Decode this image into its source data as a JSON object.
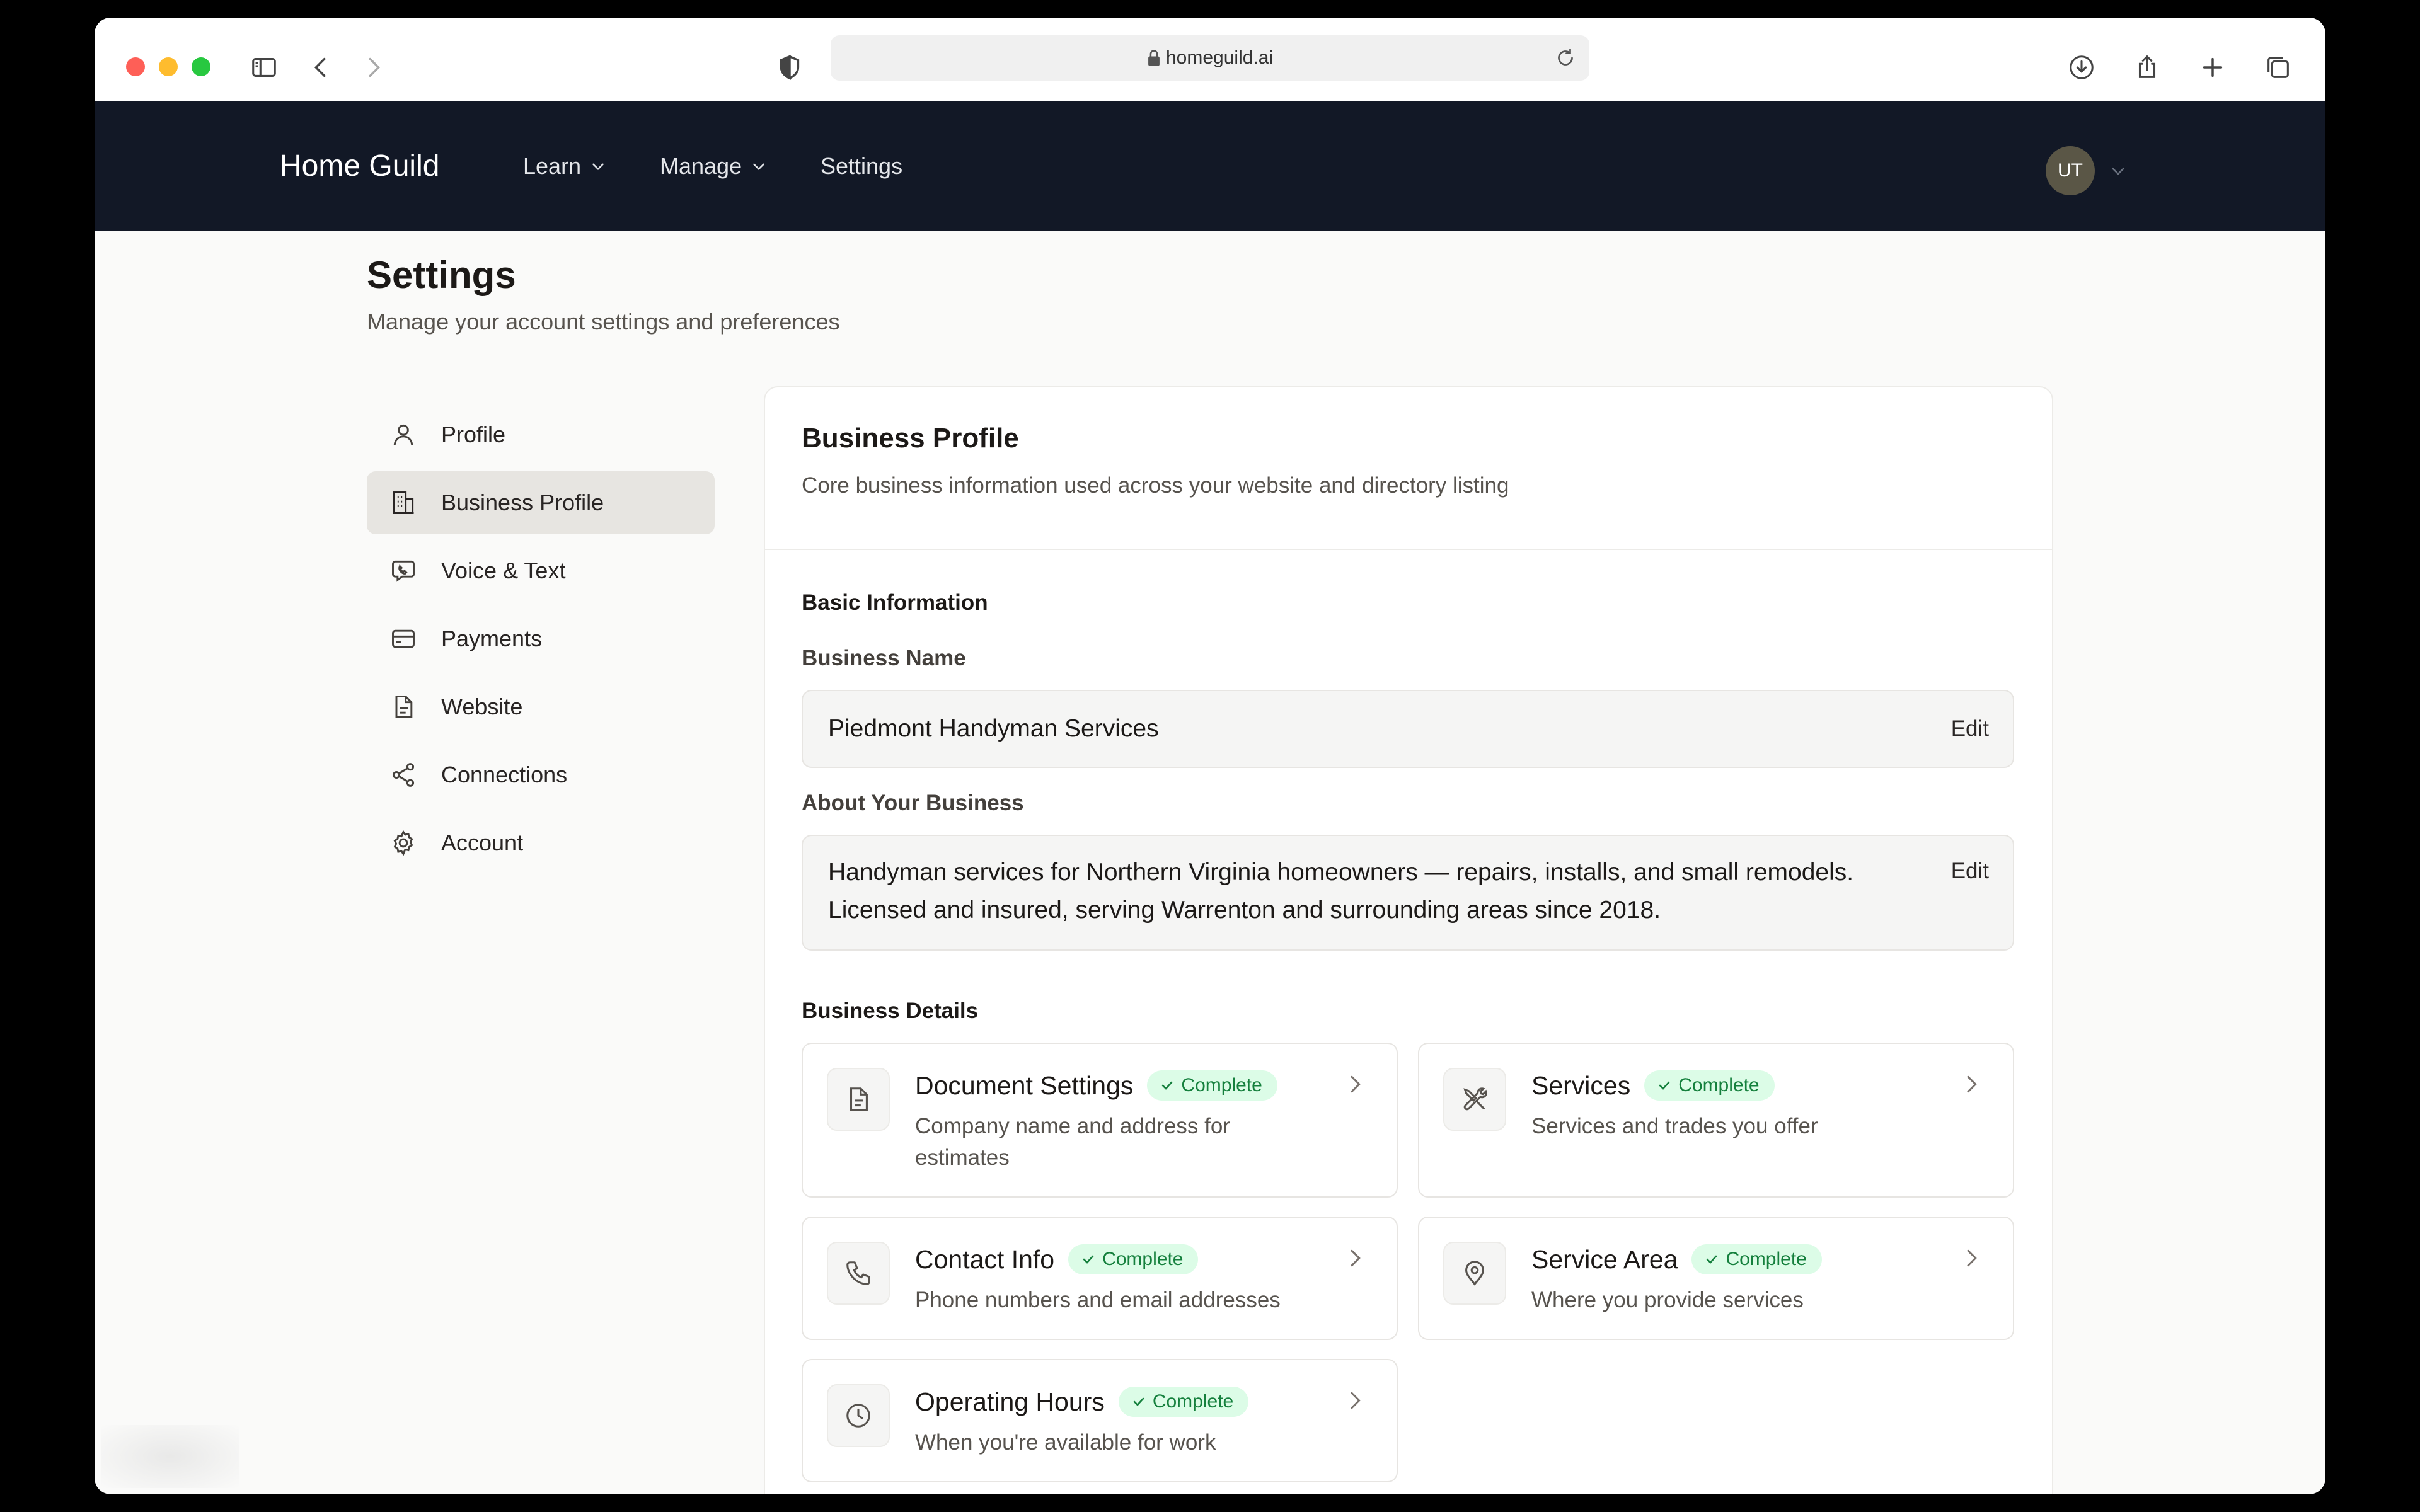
{
  "browser": {
    "url": "homeguild.ai"
  },
  "app": {
    "brand": "Home Guild",
    "nav": [
      {
        "label": "Learn"
      },
      {
        "label": "Manage"
      },
      {
        "label": "Settings"
      }
    ],
    "avatar_initials": "UT"
  },
  "page": {
    "title": "Settings",
    "subtitle": "Manage your account settings and preferences"
  },
  "sidebar": {
    "items": [
      {
        "label": "Profile",
        "icon": "user-icon"
      },
      {
        "label": "Business Profile",
        "icon": "building-icon",
        "active": true
      },
      {
        "label": "Voice & Text",
        "icon": "message-phone-icon"
      },
      {
        "label": "Payments",
        "icon": "credit-card-icon"
      },
      {
        "label": "Website",
        "icon": "file-icon"
      },
      {
        "label": "Connections",
        "icon": "share-icon"
      },
      {
        "label": "Account",
        "icon": "gear-icon"
      }
    ]
  },
  "card": {
    "title": "Business Profile",
    "description": "Core business information used across your website and directory listing",
    "basic_info_label": "Basic Information",
    "business_name_label": "Business Name",
    "business_name_value": "Piedmont Handyman Services",
    "about_label": "About Your Business",
    "about_line1": "Handyman services for Northern Virginia homeowners — repairs, installs, and small remodels.",
    "about_line2": "Licensed and insured, serving Warrenton and surrounding areas since 2018.",
    "edit_label": "Edit",
    "details_label": "Business Details",
    "status_complete": "Complete",
    "details": [
      {
        "title": "Document Settings",
        "desc_line1": "Company name and address for",
        "desc_line2": "estimates",
        "icon": "document-icon"
      },
      {
        "title": "Services",
        "desc_line1": "Services and trades you offer",
        "desc_line2": "",
        "icon": "tools-icon"
      },
      {
        "title": "Contact Info",
        "desc_line1": "Phone numbers and email addresses",
        "desc_line2": "",
        "icon": "phone-icon"
      },
      {
        "title": "Service Area",
        "desc_line1": "Where you provide services",
        "desc_line2": "",
        "icon": "map-pin-icon"
      },
      {
        "title": "Operating Hours",
        "desc_line1": "When you're available for work",
        "desc_line2": "",
        "icon": "clock-icon"
      }
    ]
  },
  "colors": {
    "nav_bg": "#121826",
    "badge_bg": "#dcfce7",
    "badge_text": "#15803d",
    "active_item_bg": "#e7e5e1"
  }
}
